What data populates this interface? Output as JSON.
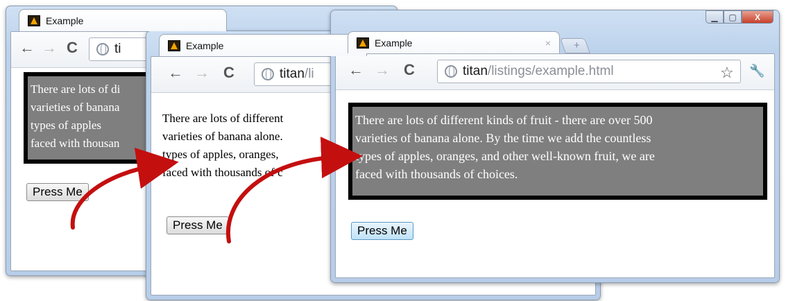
{
  "windows": [
    {
      "tab_title": "Example",
      "url_host": "ti",
      "url_path": "",
      "paragraph_lines": [
        "There are lots of di",
        "varieties of banana",
        "types of apples",
        "faced with thousan"
      ],
      "button_label": "Press Me"
    },
    {
      "tab_title": "Example",
      "url_host": "titan",
      "url_path": "/li",
      "paragraph_lines": [
        "There are lots of different",
        "varieties of banana alone.",
        "types of apples, oranges,",
        "faced with thousands of c"
      ],
      "button_label": "Press Me"
    },
    {
      "tab_title": "Example",
      "tab_close": "×",
      "url_host": "titan",
      "url_path": "/listings/example.html",
      "paragraph_lines": [
        "There are lots of different kinds of fruit - there are over 500",
        "varieties of banana alone. By the time we add the countless",
        "types of apples, oranges, and other well-known fruit, we are",
        "faced with thousands of choices."
      ],
      "button_label": "Press Me"
    }
  ],
  "nav": {
    "back": "←",
    "forward": "→",
    "reload": "C"
  },
  "toolbar_icons": {
    "star": "☆",
    "wrench": "🔧"
  },
  "window_controls": {
    "minimize": "▁",
    "maximize": "▢",
    "close": "X"
  },
  "new_tab_glyph": "+",
  "colors": {
    "arrow": "#c40f0f",
    "styled_bg": "#7f7f7f",
    "styled_border": "#000000"
  }
}
